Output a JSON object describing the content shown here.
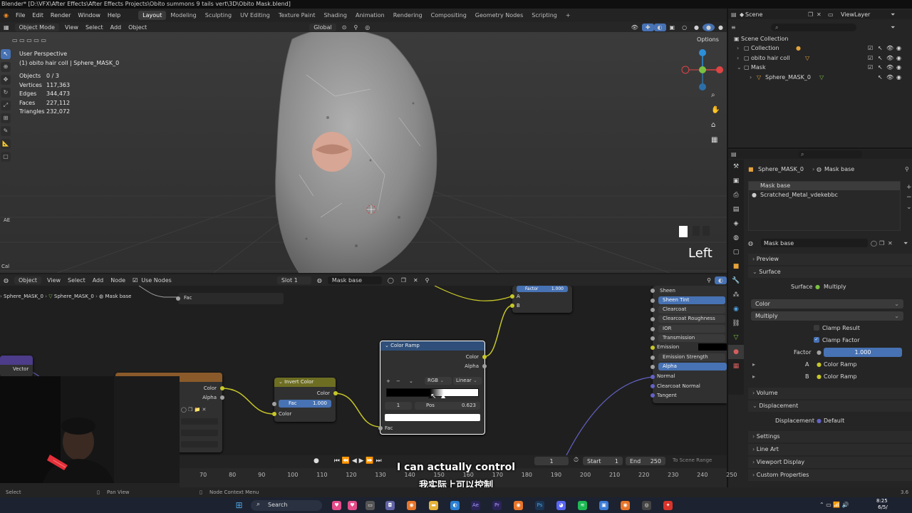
{
  "window": {
    "title": "Blender* [D:\\VFX\\After Effects\\After Effects Projects\\Obito summons 9 tails vert\\3D\\Obito Mask.blend]"
  },
  "menus": [
    "File",
    "Edit",
    "Render",
    "Window",
    "Help"
  ],
  "workspaces": [
    "Layout",
    "Modeling",
    "Sculpting",
    "UV Editing",
    "Texture Paint",
    "Shading",
    "Animation",
    "Rendering",
    "Compositing",
    "Geometry Nodes",
    "Scripting"
  ],
  "active_workspace": "Layout",
  "viewport_header": {
    "mode": "Object Mode",
    "menus": [
      "View",
      "Select",
      "Add",
      "Object"
    ],
    "orientation": "Global",
    "options": "Options"
  },
  "viewport": {
    "view_name": "User Perspective",
    "object_info": "(1) obito hair coll | Sphere_MASK_0",
    "stats": [
      {
        "label": "Objects",
        "value": "0 / 3"
      },
      {
        "label": "Vertices",
        "value": "117,363"
      },
      {
        "label": "Edges",
        "value": "344,473"
      },
      {
        "label": "Faces",
        "value": "227,112"
      },
      {
        "label": "Triangles",
        "value": "232,072"
      }
    ],
    "view_direction": "Left",
    "side_tab": "AE",
    "side_tab2": "Cal"
  },
  "outliner": {
    "scene": "Scene",
    "view_layer": "ViewLayer",
    "items": [
      {
        "label": "Scene Collection"
      },
      {
        "label": "Collection"
      },
      {
        "label": "obito hair coll"
      },
      {
        "label": "Mask"
      },
      {
        "label": "Sphere_MASK_0"
      }
    ]
  },
  "properties": {
    "breadcrumb_object": "Sphere_MASK_0",
    "breadcrumb_material": "Mask base",
    "material_slots": [
      "Mask base",
      "Scratched_Metal_vdekebbc"
    ],
    "material_name": "Mask base",
    "sections": {
      "preview": "Preview",
      "surface": "Surface",
      "volume": "Volume",
      "displacement": "Displacement",
      "settings": "Settings",
      "line_art": "Line Art",
      "viewport_display": "Viewport Display",
      "custom_properties": "Custom Properties"
    },
    "surface_label": "Surface",
    "surface_value": "Multiply",
    "color_dropdown": "Color",
    "blend_dropdown": "Multiply",
    "clamp_result": "Clamp Result",
    "clamp_factor": "Clamp Factor",
    "factor_label": "Factor",
    "factor_value": "1.000",
    "a_label": "A",
    "a_value": "Color Ramp",
    "b_label": "B",
    "b_value": "Color Ramp",
    "displacement_label": "Displacement",
    "displacement_value": "Default",
    "version": "3.6"
  },
  "node_editor_header": {
    "type": "Object",
    "menus": [
      "View",
      "Select",
      "Add",
      "Node"
    ],
    "use_nodes": "Use Nodes",
    "slot": "Slot 1",
    "material": "Mask base"
  },
  "node_breadcrumb": [
    "Sphere_MASK_0",
    "Sphere_MASK_0",
    "Mask base"
  ],
  "nodes": {
    "fac_label": "Fac",
    "vector_label": "Vector",
    "texture_outputs": [
      "Color",
      "Alpha"
    ],
    "invert": {
      "title": "Invert Color",
      "output": "Color",
      "fac_label": "Fac",
      "fac_value": "1.000",
      "color_input": "Color"
    },
    "ramp": {
      "title": "Color Ramp",
      "outputs": [
        "Color",
        "Alpha"
      ],
      "mode": "RGB",
      "interp": "Linear",
      "index": "1",
      "pos_label": "Pos",
      "pos_value": "0.623",
      "pos_fraction": 0.623,
      "fac_input": "Fac"
    },
    "mix": {
      "factor_label": "Factor",
      "factor_value": "1.000",
      "inputs": [
        "A",
        "B"
      ]
    },
    "bsdf_inputs": [
      "Sheen",
      "Sheen Tint",
      "Clearcoat",
      "Clearcoat Roughness",
      "IOR",
      "Transmission",
      "Emission",
      "Emission Strength",
      "Alpha",
      "Normal",
      "Clearcoat Normal",
      "Tangent"
    ]
  },
  "timeline": {
    "current_frame": "1",
    "start_label": "Start",
    "start": "1",
    "end_label": "End",
    "end": "250",
    "scene_range": "To Scene Range",
    "ruler": [
      "70",
      "80",
      "90",
      "100",
      "110",
      "120",
      "130",
      "140",
      "150",
      "160",
      "170",
      "180",
      "190",
      "200",
      "210",
      "220",
      "230",
      "240",
      "250"
    ]
  },
  "statusbar": {
    "select": "Select",
    "pan": "Pan View",
    "context": "Node Context Menu"
  },
  "subtitles": {
    "en": "I can actually control",
    "zh": "我实际上可以控制"
  },
  "taskbar": {
    "search": "Search",
    "time": "8:25",
    "date": "6/5/"
  },
  "colors": {
    "accent": "#4772b3",
    "socket_yellow": "#c7c729",
    "socket_gray": "#a1a1a1",
    "socket_purple": "#6363c7"
  }
}
